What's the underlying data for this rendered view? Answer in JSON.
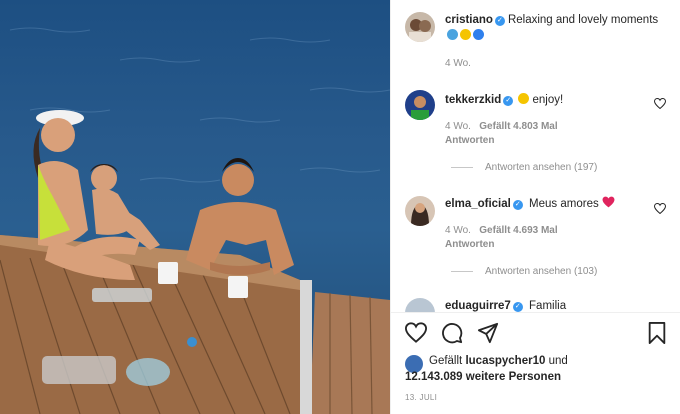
{
  "post": {
    "author": "cristiano",
    "caption": "Relaxing and lovely moments",
    "caption_age": "4 Wo.",
    "date": "13. JULI"
  },
  "comments": [
    {
      "user": "tekkerzkid",
      "text": "enjoy!",
      "age": "4 Wo.",
      "likes": "Gefällt 4.803 Mal",
      "reply": "Antworten",
      "view_replies": "Antworten ansehen (197)"
    },
    {
      "user": "elma_oficial",
      "text": "Meus amores",
      "age": "4 Wo.",
      "likes": "Gefällt 4.693 Mal",
      "reply": "Antworten",
      "view_replies": "Antworten ansehen (103)"
    },
    {
      "user": "eduaguirre7",
      "text": "Familia"
    }
  ],
  "liked_by": {
    "prefix": "Gefällt",
    "user": "lucaspycher10",
    "connector": "und",
    "count": "12.143.089 weitere Personen"
  },
  "icons": {
    "like": "heart-icon",
    "comment": "comment-icon",
    "share": "share-icon",
    "save": "bookmark-icon"
  },
  "colors": {
    "verified": "#3897f0",
    "heart_red": "#ed4956",
    "sea": "#285a8c",
    "deck": "#9a6a45"
  }
}
